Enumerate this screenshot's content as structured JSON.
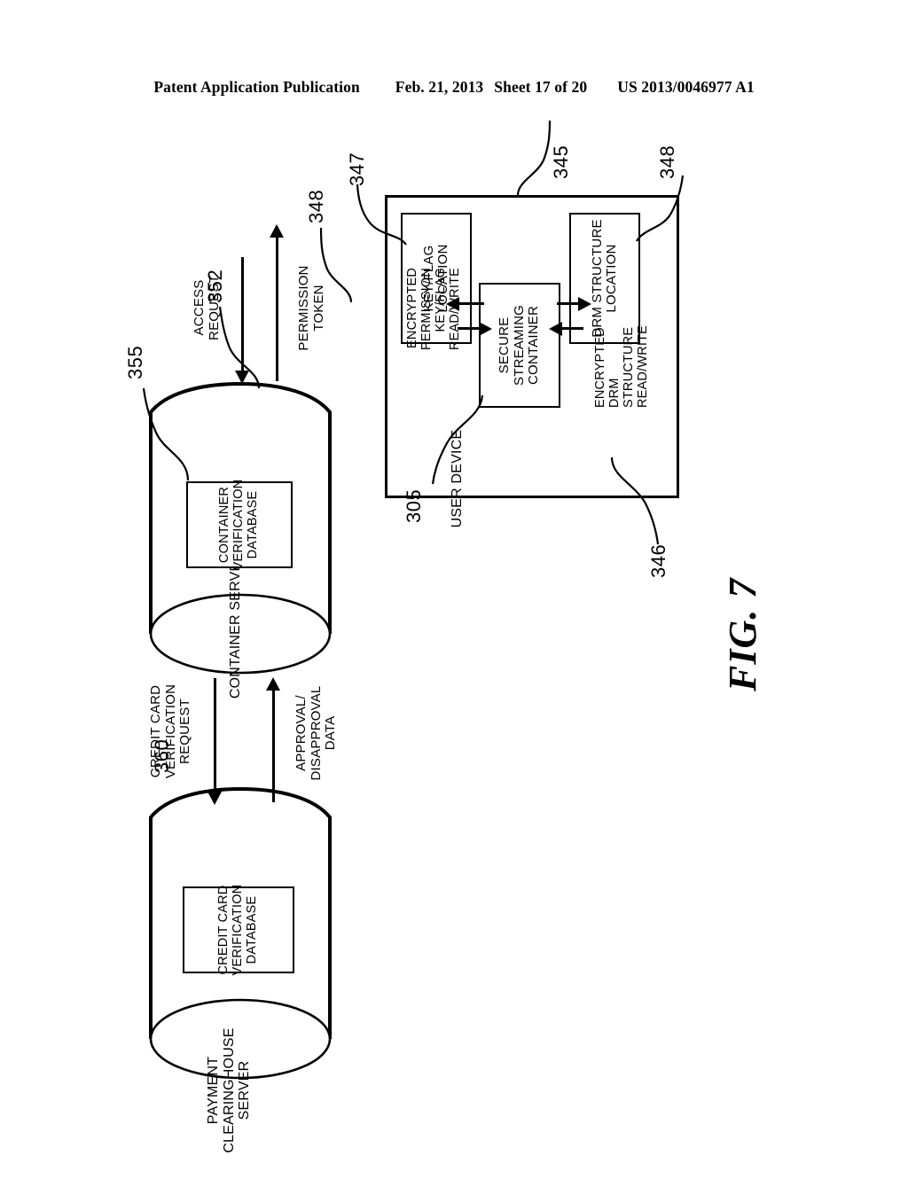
{
  "header": {
    "publication": "Patent Application Publication",
    "date": "Feb. 21, 2013",
    "sheet": "Sheet 17 of 20",
    "patent_number": "US 2013/0046977 A1"
  },
  "figure": {
    "label": "FIG. 7"
  },
  "nodes": {
    "payment_clearinghouse_server": {
      "label": "PAYMENT\nCLEARINGHOUSE\nSERVER",
      "ref": "360",
      "inner_db": {
        "label": "CREDIT CARD\nVERIFICATION\nDATABASE"
      }
    },
    "container_server": {
      "label": "CONTAINER SERVER",
      "ref": "352",
      "inner_db": {
        "label": "CONTAINER\nVERIFICATION\nDATABASE",
        "ref": "355"
      }
    },
    "user_device": {
      "label": "USER DEVICE",
      "ref": "346",
      "inner_ref": "345",
      "secure_streaming_container": {
        "label": "SECURE\nSTREAMING\nCONTAINER",
        "ref": "305"
      },
      "key_flag_location": {
        "label": "KEY/FLAG\nLOCATION",
        "ref": "347"
      },
      "drm_structure_location": {
        "label": "DRM STRUCTURE\nLOCATION",
        "ref": "348"
      }
    }
  },
  "connections": {
    "credit_card_verification_request": "CREDIT CARD\nVERIFICATION\nREQUEST",
    "approval_disapproval_data": "APPROVAL/\nDISAPPROVAL\nDATA",
    "access_request": "ACCESS\nREQUEST",
    "permission_token": "PERMISSION\nTOKEN",
    "permission_token_ref": "348",
    "encrypted_permission_key_flag": "ENCRYPTED\nPERMISSION\nKEY/FLAG\nREAD/WRITE",
    "encrypted_drm_structure": "ENCRYPTED\nDRM\nSTRUCTURE\nREAD/WRITE"
  }
}
